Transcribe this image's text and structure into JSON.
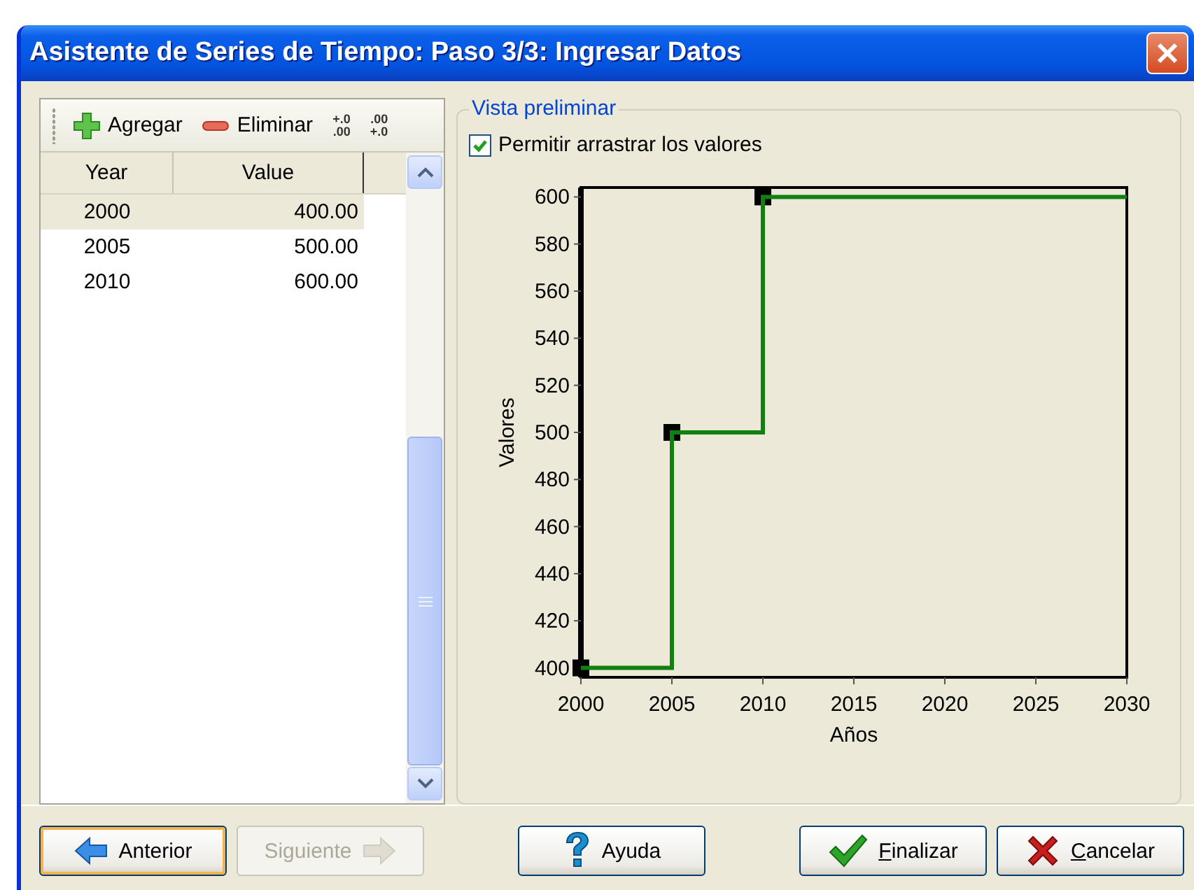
{
  "window": {
    "title": "Asistente de Series de Tiempo: Paso 3/3: Ingresar Datos"
  },
  "toolbar": [
    {
      "kind": "add",
      "label": "Agregar"
    },
    {
      "kind": "remove",
      "label": "Eliminar"
    },
    {
      "kind": "more_decimals",
      "top": "+.0",
      "bottom": ".00"
    },
    {
      "kind": "fewer_decimals",
      "top": ".00",
      "bottom": "+.0"
    }
  ],
  "table": {
    "columns": [
      "Year",
      "Value"
    ],
    "rows": [
      {
        "cells": [
          "2000",
          "400.00"
        ],
        "selected": true
      },
      {
        "cells": [
          "2005",
          "500.00"
        ],
        "selected": false
      },
      {
        "cells": [
          "2010",
          "600.00"
        ],
        "selected": false
      }
    ]
  },
  "preview": {
    "title": "Vista preliminar",
    "drag_option": {
      "label": "Permitir arrastrar los valores",
      "checked": true
    },
    "chart_data": {
      "type": "line",
      "xlabel": "Años",
      "ylabel": "Valores",
      "x": [
        2000,
        2005,
        2005,
        2010,
        2010,
        2030
      ],
      "series": [
        {
          "color": "#108010",
          "marker": "square",
          "values": [
            400,
            400,
            500,
            500,
            600,
            600
          ]
        }
      ],
      "xlim": [
        2000,
        2030
      ],
      "ylim": [
        396,
        604
      ],
      "xticks": [
        2000,
        2005,
        2010,
        2015,
        2020,
        2025,
        2030
      ],
      "yticks": [
        400,
        420,
        440,
        460,
        480,
        500,
        520,
        540,
        560,
        580,
        600
      ]
    }
  },
  "buttons": [
    {
      "kind": "back",
      "label": "Anterior",
      "disabled": false,
      "focused": true
    },
    {
      "kind": "next",
      "label": "Siguiente",
      "disabled": true,
      "focused": false
    },
    {
      "kind": "help",
      "label": "Ayuda",
      "disabled": false,
      "focused": false
    },
    {
      "kind": "finish",
      "label": "Finalizar",
      "disabled": false,
      "focused": false
    },
    {
      "kind": "cancel",
      "label": "Cancelar",
      "disabled": false,
      "focused": false
    }
  ]
}
